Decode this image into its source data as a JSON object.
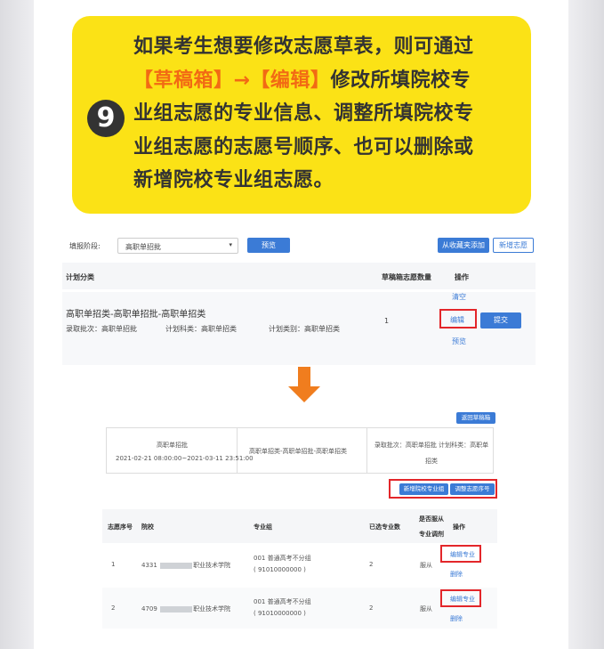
{
  "callout": {
    "step_number": "9",
    "line1": "如果考生想要修改志愿草表，则可通过",
    "line2_hl": "【草稿箱】→【编辑】",
    "line2_rest": "修改所填院校专",
    "line3": "业组志愿的专业信息、调整所填院校专",
    "line4": "业组志愿的志愿号顺序、也可以删除或",
    "line5": "新增院校专业组志愿。",
    "highlight_color": "#f26a14",
    "background_color": "#fbe216"
  },
  "top_panel": {
    "stage_label": "填报阶段:",
    "stage_value": "高职单招批",
    "dropdown_icon": "chevron-down-icon",
    "preview_button": "预览",
    "add_from_favorites_button": "从收藏夹添加",
    "add_new_button": "新增志愿",
    "header": {
      "plan_category": "计划分类",
      "draft_count": "草稿箱志愿数量",
      "actions": "操作"
    },
    "row": {
      "title": "高职单招类-高职单招批-高职单招类",
      "batch": "录取批次：高职单招批",
      "subject": "计划科类：高职单招类",
      "category": "计划类别：高职单招类",
      "count": "1",
      "clear": "清空",
      "edit": "编辑",
      "submit": "提交",
      "preview": "预览"
    }
  },
  "bottom_panel": {
    "back_button": "返回草稿箱",
    "info": {
      "batch_name": "高职单招批",
      "time_range": "2021-02-21 08:00:00~2021-03-11 23:51:00",
      "type": "高职单招类-高职单招批-高职单招类",
      "detail": "录取批次：高职单招批 计划科类：高职单招类"
    },
    "add_group_button": "新增院校专业组",
    "adjust_order_button": "调整志愿序号",
    "columns": {
      "seq": "志愿序号",
      "school": "院校",
      "group": "专业组",
      "selected": "已选专业数",
      "obey_1": "是否服从",
      "obey_2": "专业调剂",
      "actions": "操作"
    },
    "rows": [
      {
        "seq": "1",
        "code": "4331",
        "school_suffix": "职业技术学院",
        "group": "001 普通高考不分组",
        "group_code": "( 91010000000 )",
        "selected": "2",
        "obey": "服从",
        "edit": "编辑专业",
        "delete": "删除"
      },
      {
        "seq": "2",
        "code": "4709",
        "school_suffix": "职业技术学院",
        "group": "001 普通高考不分组",
        "group_code": "( 91010000000 )",
        "selected": "2",
        "obey": "服从",
        "edit": "编辑专业",
        "delete": "删除"
      }
    ]
  },
  "colors": {
    "accent_blue": "#3b7bd6",
    "highlight_red": "#e3262a",
    "arrow_orange": "#f07d1e"
  }
}
